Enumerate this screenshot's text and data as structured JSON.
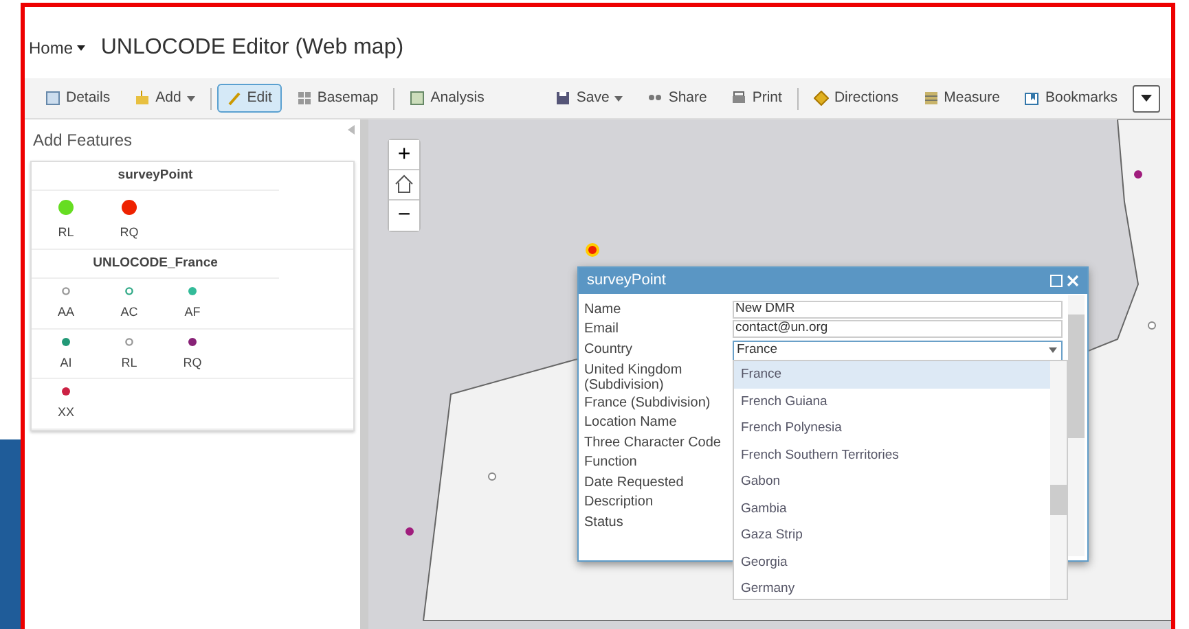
{
  "header": {
    "home": "Home",
    "title": "UNLOCODE Editor (Web map)"
  },
  "toolbar": {
    "left": [
      {
        "label": "Details",
        "caret": false,
        "selected": false
      },
      {
        "label": "Add",
        "caret": true,
        "selected": false
      },
      {
        "label": "Edit",
        "caret": false,
        "selected": true
      },
      {
        "label": "Basemap",
        "caret": false,
        "selected": false
      },
      {
        "label": "Analysis",
        "caret": false,
        "selected": false
      }
    ],
    "right": [
      {
        "label": "Save",
        "caret": true
      },
      {
        "label": "Share",
        "caret": false
      },
      {
        "label": "Print",
        "caret": false
      },
      {
        "label": "Directions",
        "caret": false
      },
      {
        "label": "Measure",
        "caret": false
      },
      {
        "label": "Bookmarks",
        "caret": false
      }
    ]
  },
  "panel": {
    "title": "Add Features",
    "groups": [
      {
        "name": "surveyPoint",
        "rows": [
          [
            {
              "label": "RL",
              "color": "#66dd22",
              "kind": "large"
            },
            {
              "label": "RQ",
              "color": "#ee2200",
              "kind": "large"
            }
          ]
        ]
      },
      {
        "name": "UNLOCODE_France",
        "rows": [
          [
            {
              "label": "AA",
              "color": "#999999",
              "kind": "hollow"
            },
            {
              "label": "AC",
              "color": "#33aa88",
              "kind": "hollow"
            },
            {
              "label": "AF",
              "color": "#33bb99",
              "kind": "filled"
            }
          ],
          [
            {
              "label": "AI",
              "color": "#229977",
              "kind": "filled"
            },
            {
              "label": "RL",
              "color": "#999999",
              "kind": "hollow"
            },
            {
              "label": "RQ",
              "color": "#882277",
              "kind": "filled"
            }
          ],
          [
            {
              "label": "XX",
              "color": "#cc2244",
              "kind": "filled"
            }
          ]
        ]
      }
    ]
  },
  "map_controls": {
    "zoom_in": "+",
    "zoom_out": "−"
  },
  "popup": {
    "title": "surveyPoint",
    "fields": [
      {
        "label": "Name",
        "value": "New DMR",
        "kind": "text"
      },
      {
        "label": "Email",
        "value": "contact@un.org",
        "kind": "text"
      },
      {
        "label": "Country",
        "value": "France",
        "kind": "combo"
      },
      {
        "label": "United Kingdom (Subdivision)",
        "kind": "label"
      },
      {
        "label": "France (Subdivision)",
        "kind": "label"
      },
      {
        "label": "Location Name",
        "kind": "label"
      },
      {
        "label": "Three Character Code",
        "kind": "label"
      },
      {
        "label": "Function",
        "kind": "label"
      },
      {
        "label": "Date Requested",
        "kind": "label"
      },
      {
        "label": "Description",
        "kind": "label"
      },
      {
        "label": "Status",
        "kind": "label"
      }
    ],
    "options": [
      {
        "label": "France",
        "selected": true
      },
      {
        "label": "French Guiana",
        "selected": false
      },
      {
        "label": "French Polynesia",
        "selected": false
      },
      {
        "label": "French Southern Territories",
        "selected": false
      },
      {
        "label": "Gabon",
        "selected": false
      },
      {
        "label": "Gambia",
        "selected": false
      },
      {
        "label": "Gaza Strip",
        "selected": false
      },
      {
        "label": "Georgia",
        "selected": false
      },
      {
        "label": "Germany",
        "selected": false
      }
    ]
  }
}
